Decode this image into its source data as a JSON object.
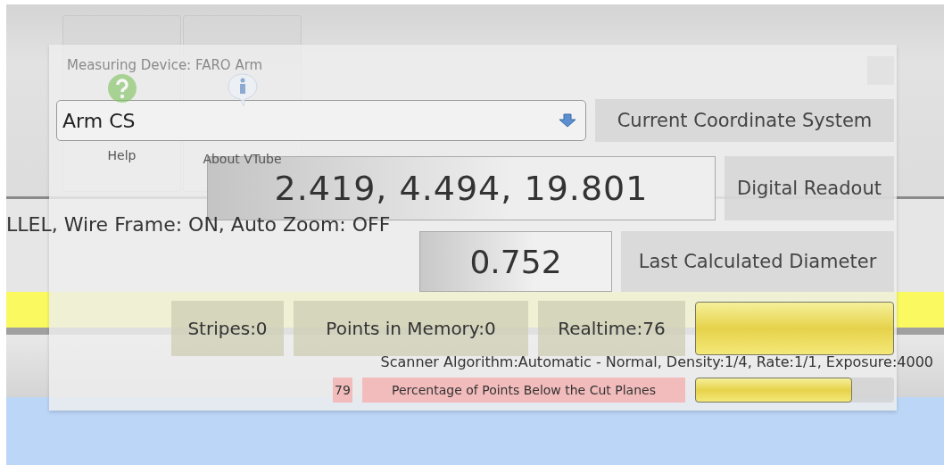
{
  "toolbar": {
    "buttons": [
      {
        "label": "Help",
        "kind": "help"
      },
      {
        "label": "About VTube",
        "kind": "info"
      }
    ]
  },
  "view_status": "LLEL, Wire Frame: ON, Auto Zoom: OFF",
  "scanner_status": "Scanner Algorithm:Automatic - Normal, Density:1/4, Rate:1/1, Exposure:4000",
  "dialog": {
    "title": "Measuring Device: FARO Arm",
    "coordinate_system": {
      "value": "Arm CS",
      "label": "Current Coordinate System"
    },
    "readout": {
      "value": "2.419, 4.494, 19.801",
      "label": "Digital Readout"
    },
    "diameter": {
      "value": "0.752",
      "label": "Last Calculated Diameter"
    },
    "counters": [
      {
        "text": "Stripes:0"
      },
      {
        "text": "Points in Memory:0"
      },
      {
        "text": "Realtime:76"
      }
    ],
    "realtime_meter": {
      "level": 1
    },
    "cut_planes": {
      "value": "79",
      "label": "Percentage of Points Below the Cut Planes",
      "level": 0.79
    }
  }
}
